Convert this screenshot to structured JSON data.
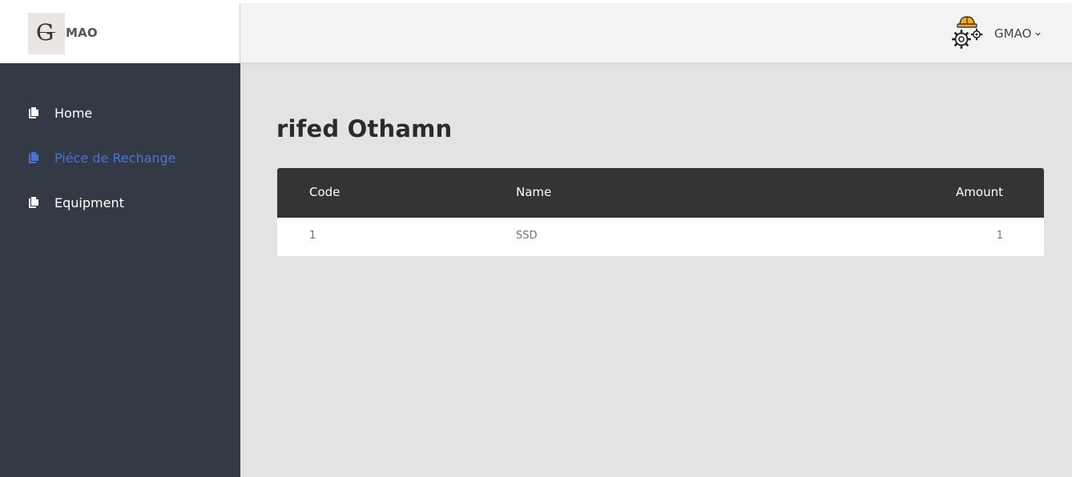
{
  "brand": {
    "logo_letter": "G",
    "name": "MAO"
  },
  "header": {
    "user_name": "GMAO"
  },
  "sidebar": {
    "items": [
      {
        "label": "Home",
        "active": false
      },
      {
        "label": "Piéce de Rechange",
        "active": true
      },
      {
        "label": "Equipment",
        "active": false
      }
    ]
  },
  "main": {
    "title": "rifed Othamn",
    "table": {
      "columns": [
        "Code",
        "Name",
        "Amount"
      ],
      "rows": [
        {
          "code": "1",
          "name": "SSD",
          "amount": "1"
        }
      ]
    }
  },
  "colors": {
    "sidebar_bg": "#343a45",
    "active_link": "#4a72d9",
    "table_header_bg": "#343434",
    "content_bg": "#e3e3e3"
  }
}
